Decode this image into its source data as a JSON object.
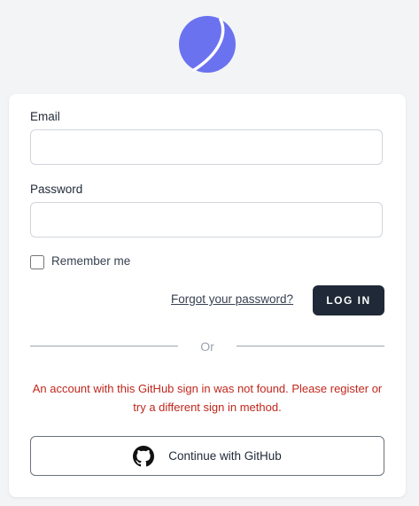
{
  "colors": {
    "brand": "#6b72f0",
    "background": "#f3f4f6",
    "card": "#ffffff",
    "primary_button": "#1f2937",
    "error": "#c0271d",
    "divider": "#9ca3af"
  },
  "logo": {
    "icon": "planet-logo-icon"
  },
  "form": {
    "email_label": "Email",
    "email_value": "",
    "password_label": "Password",
    "password_value": "",
    "remember_label": "Remember me",
    "remember_checked": false,
    "forgot_link": "Forgot your password?",
    "login_button": "LOG IN"
  },
  "divider": {
    "text": "Or"
  },
  "error_message": "An account with this GitHub sign in was not found. Please register or try a different sign in method.",
  "github": {
    "icon": "github-icon",
    "label": "Continue with GitHub"
  }
}
